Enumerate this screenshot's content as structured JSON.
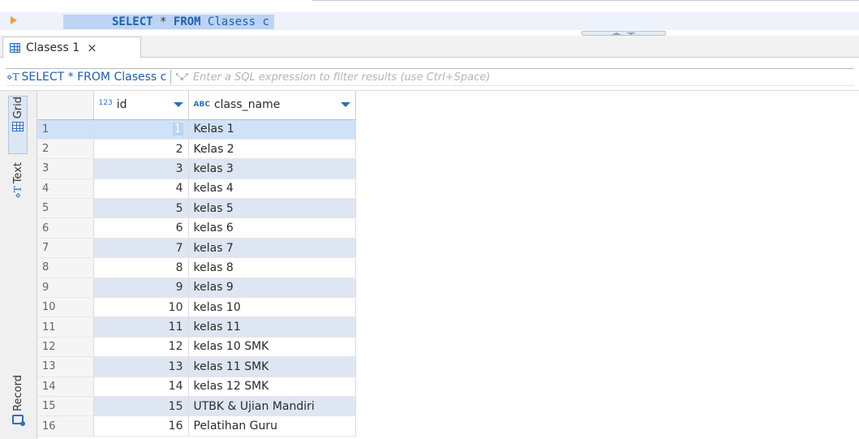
{
  "editor": {
    "query_select": "SELECT",
    "query_star": "*",
    "query_from": "FROM",
    "query_table": "Clasess c"
  },
  "tabs": [
    {
      "label": "Clasess 1",
      "close": "×"
    }
  ],
  "filter": {
    "sql": "SELECT * FROM Clasess c",
    "placeholder": "Enter a SQL expression to filter results (use Ctrl+Space)"
  },
  "side_tabs": {
    "grid": "Grid",
    "text": "Text",
    "record": "Record"
  },
  "columns": {
    "id": {
      "label": "id",
      "type_icon": "123"
    },
    "class_name": {
      "label": "class_name",
      "type_icon": "ABC"
    }
  },
  "rows": [
    {
      "num": "1",
      "id": "1",
      "class_name": "Kelas 1"
    },
    {
      "num": "2",
      "id": "2",
      "class_name": "Kelas 2"
    },
    {
      "num": "3",
      "id": "3",
      "class_name": "kelas 3"
    },
    {
      "num": "4",
      "id": "4",
      "class_name": "kelas 4"
    },
    {
      "num": "5",
      "id": "5",
      "class_name": "kelas 5"
    },
    {
      "num": "6",
      "id": "6",
      "class_name": "kelas 6"
    },
    {
      "num": "7",
      "id": "7",
      "class_name": "kelas 7"
    },
    {
      "num": "8",
      "id": "8",
      "class_name": "kelas 8"
    },
    {
      "num": "9",
      "id": "9",
      "class_name": "kelas 9"
    },
    {
      "num": "10",
      "id": "10",
      "class_name": "kelas 10"
    },
    {
      "num": "11",
      "id": "11",
      "class_name": "kelas 11"
    },
    {
      "num": "12",
      "id": "12",
      "class_name": "kelas 10 SMK"
    },
    {
      "num": "13",
      "id": "13",
      "class_name": "kelas 11 SMK"
    },
    {
      "num": "14",
      "id": "14",
      "class_name": "kelas 12 SMK"
    },
    {
      "num": "15",
      "id": "15",
      "class_name": "UTBK & Ujian Mandiri"
    },
    {
      "num": "16",
      "id": "16",
      "class_name": "Pelatihan Guru"
    }
  ],
  "colors": {
    "accent": "#2a70c0",
    "keyword": "#1e5fb3",
    "selection": "#bcd3f3",
    "alt_row": "#dde6f2",
    "run_arrow": "#f0a030"
  }
}
